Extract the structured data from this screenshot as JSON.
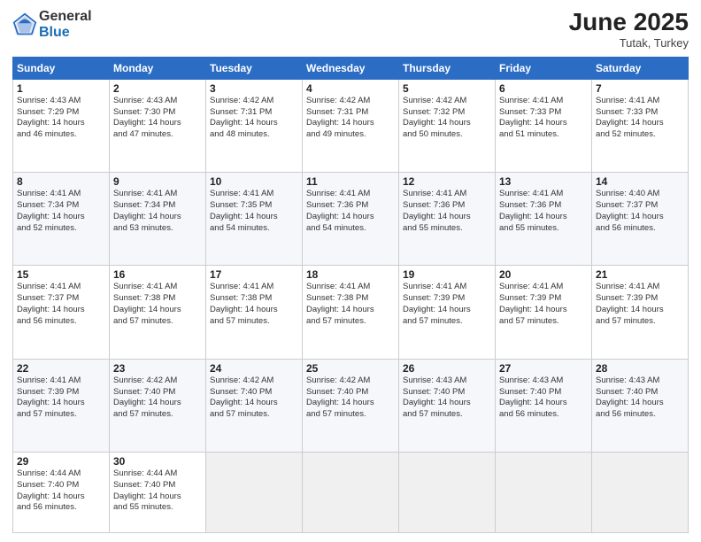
{
  "logo": {
    "general": "General",
    "blue": "Blue"
  },
  "title": {
    "month_year": "June 2025",
    "location": "Tutak, Turkey"
  },
  "days_header": [
    "Sunday",
    "Monday",
    "Tuesday",
    "Wednesday",
    "Thursday",
    "Friday",
    "Saturday"
  ],
  "weeks": [
    [
      {
        "day": "1",
        "info": "Sunrise: 4:43 AM\nSunset: 7:29 PM\nDaylight: 14 hours\nand 46 minutes."
      },
      {
        "day": "2",
        "info": "Sunrise: 4:43 AM\nSunset: 7:30 PM\nDaylight: 14 hours\nand 47 minutes."
      },
      {
        "day": "3",
        "info": "Sunrise: 4:42 AM\nSunset: 7:31 PM\nDaylight: 14 hours\nand 48 minutes."
      },
      {
        "day": "4",
        "info": "Sunrise: 4:42 AM\nSunset: 7:31 PM\nDaylight: 14 hours\nand 49 minutes."
      },
      {
        "day": "5",
        "info": "Sunrise: 4:42 AM\nSunset: 7:32 PM\nDaylight: 14 hours\nand 50 minutes."
      },
      {
        "day": "6",
        "info": "Sunrise: 4:41 AM\nSunset: 7:33 PM\nDaylight: 14 hours\nand 51 minutes."
      },
      {
        "day": "7",
        "info": "Sunrise: 4:41 AM\nSunset: 7:33 PM\nDaylight: 14 hours\nand 52 minutes."
      }
    ],
    [
      {
        "day": "8",
        "info": "Sunrise: 4:41 AM\nSunset: 7:34 PM\nDaylight: 14 hours\nand 52 minutes."
      },
      {
        "day": "9",
        "info": "Sunrise: 4:41 AM\nSunset: 7:34 PM\nDaylight: 14 hours\nand 53 minutes."
      },
      {
        "day": "10",
        "info": "Sunrise: 4:41 AM\nSunset: 7:35 PM\nDaylight: 14 hours\nand 54 minutes."
      },
      {
        "day": "11",
        "info": "Sunrise: 4:41 AM\nSunset: 7:36 PM\nDaylight: 14 hours\nand 54 minutes."
      },
      {
        "day": "12",
        "info": "Sunrise: 4:41 AM\nSunset: 7:36 PM\nDaylight: 14 hours\nand 55 minutes."
      },
      {
        "day": "13",
        "info": "Sunrise: 4:41 AM\nSunset: 7:36 PM\nDaylight: 14 hours\nand 55 minutes."
      },
      {
        "day": "14",
        "info": "Sunrise: 4:40 AM\nSunset: 7:37 PM\nDaylight: 14 hours\nand 56 minutes."
      }
    ],
    [
      {
        "day": "15",
        "info": "Sunrise: 4:41 AM\nSunset: 7:37 PM\nDaylight: 14 hours\nand 56 minutes."
      },
      {
        "day": "16",
        "info": "Sunrise: 4:41 AM\nSunset: 7:38 PM\nDaylight: 14 hours\nand 57 minutes."
      },
      {
        "day": "17",
        "info": "Sunrise: 4:41 AM\nSunset: 7:38 PM\nDaylight: 14 hours\nand 57 minutes."
      },
      {
        "day": "18",
        "info": "Sunrise: 4:41 AM\nSunset: 7:38 PM\nDaylight: 14 hours\nand 57 minutes."
      },
      {
        "day": "19",
        "info": "Sunrise: 4:41 AM\nSunset: 7:39 PM\nDaylight: 14 hours\nand 57 minutes."
      },
      {
        "day": "20",
        "info": "Sunrise: 4:41 AM\nSunset: 7:39 PM\nDaylight: 14 hours\nand 57 minutes."
      },
      {
        "day": "21",
        "info": "Sunrise: 4:41 AM\nSunset: 7:39 PM\nDaylight: 14 hours\nand 57 minutes."
      }
    ],
    [
      {
        "day": "22",
        "info": "Sunrise: 4:41 AM\nSunset: 7:39 PM\nDaylight: 14 hours\nand 57 minutes."
      },
      {
        "day": "23",
        "info": "Sunrise: 4:42 AM\nSunset: 7:40 PM\nDaylight: 14 hours\nand 57 minutes."
      },
      {
        "day": "24",
        "info": "Sunrise: 4:42 AM\nSunset: 7:40 PM\nDaylight: 14 hours\nand 57 minutes."
      },
      {
        "day": "25",
        "info": "Sunrise: 4:42 AM\nSunset: 7:40 PM\nDaylight: 14 hours\nand 57 minutes."
      },
      {
        "day": "26",
        "info": "Sunrise: 4:43 AM\nSunset: 7:40 PM\nDaylight: 14 hours\nand 57 minutes."
      },
      {
        "day": "27",
        "info": "Sunrise: 4:43 AM\nSunset: 7:40 PM\nDaylight: 14 hours\nand 56 minutes."
      },
      {
        "day": "28",
        "info": "Sunrise: 4:43 AM\nSunset: 7:40 PM\nDaylight: 14 hours\nand 56 minutes."
      }
    ],
    [
      {
        "day": "29",
        "info": "Sunrise: 4:44 AM\nSunset: 7:40 PM\nDaylight: 14 hours\nand 56 minutes."
      },
      {
        "day": "30",
        "info": "Sunrise: 4:44 AM\nSunset: 7:40 PM\nDaylight: 14 hours\nand 55 minutes."
      },
      null,
      null,
      null,
      null,
      null
    ]
  ]
}
